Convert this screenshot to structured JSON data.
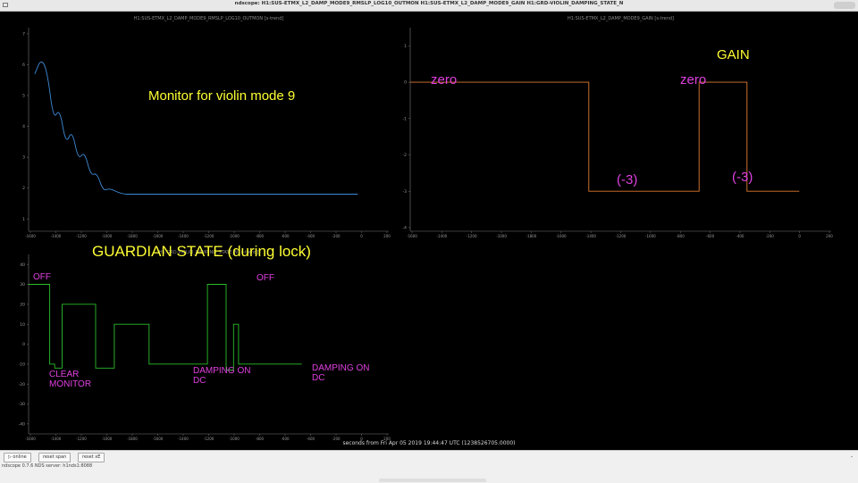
{
  "window": {
    "title": "ndscope: H1:SUS-ETMX_L2_DAMP_MODE9_RMSLP_LOG10_OUTMON H1:SUS-ETMX_L2_DAMP_MODE9_GAIN H1:GRD-VIOLIN_DAMPING_STATE_N"
  },
  "colors": {
    "monitor_trace": "#3d8bd6",
    "gain_trace": "#e07a2e",
    "guardian_trace": "#2bbd2b",
    "annotation_magenta": "#e040e0",
    "annotation_yellow": "#ffff33",
    "axis_text": "#9a9a9a"
  },
  "x_axis": {
    "label": "seconds from Fri Apr 05 2019 19:44:47 UTC (1238526705.0000)",
    "ticks": [
      "-1600",
      "-1400",
      "-1200",
      "-1000",
      "-1800",
      "-1600",
      "-1400",
      "-1200",
      "-1000",
      "-800",
      "-600",
      "-400",
      "-200",
      "0",
      "200"
    ]
  },
  "monitor_plot": {
    "title": "H1:SUS-ETMX_L2_DAMP_MODE9_RMSLP_LOG10_OUTMON [s-trend]",
    "annotation": "Monitor for violin mode 9",
    "y_ticks": [
      "7",
      "6",
      "5",
      "4",
      "3",
      "2",
      "1"
    ]
  },
  "gain_plot": {
    "title": "H1:SUS-ETMX_L2_DAMP_MODE9_GAIN [s-trend]",
    "y_ticks": [
      "1",
      "0",
      "-1",
      "-2",
      "-3",
      "-4"
    ],
    "annotations": {
      "heading": "GAIN",
      "zero_left": "zero",
      "zero_right": "zero",
      "minus_left": "(-3)",
      "minus_right": "(-3)"
    }
  },
  "guardian_plot": {
    "title": "H1:GRD-VIOLIN_DAMPING_STATE_N [s-trend]",
    "y_ticks": [
      "40",
      "30",
      "20",
      "10",
      "0",
      "-10",
      "-20",
      "-30",
      "-40"
    ],
    "annotations": {
      "heading": "GUARDIAN STATE (during lock)",
      "off_left": "OFF",
      "off_right": "OFF",
      "clear_monitor": "CLEAR\nMONITOR",
      "damping_left": "DAMPING ON\nDC",
      "damping_right": "DAMPING ON\nDC"
    }
  },
  "chart_data": [
    {
      "type": "line",
      "title": "H1:SUS-ETMX_L2_DAMP_MODE9_RMSLP_LOG10_OUTMON [s-trend]",
      "xlim": [
        -2650,
        250
      ],
      "ylim": [
        0.6,
        7.2
      ],
      "series": [
        {
          "x": [
            -2600,
            -2550,
            -2500,
            -2450,
            -2400,
            -2350,
            -2300,
            -2250,
            -2200,
            -2150,
            -2100,
            -2050,
            -2000,
            -1900,
            -1800,
            -1500,
            -1000,
            -500,
            0
          ],
          "y": [
            5.7,
            6.2,
            5.8,
            4.2,
            4.6,
            3.4,
            3.9,
            2.9,
            3.2,
            2.4,
            2.5,
            1.9,
            2.0,
            1.8,
            1.8,
            1.8,
            1.8,
            1.8,
            1.8
          ]
        }
      ]
    },
    {
      "type": "line",
      "title": "H1:SUS-ETMX_L2_DAMP_MODE9_GAIN [s-trend]",
      "xlim": [
        -2650,
        250
      ],
      "ylim": [
        -4.1,
        1.5
      ],
      "series": [
        {
          "x": [
            -2650,
            -1420,
            -1420,
            -660,
            -660,
            -330,
            -330,
            30
          ],
          "y": [
            0,
            0,
            -3,
            -3,
            0,
            0,
            -3,
            -3
          ]
        }
      ]
    },
    {
      "type": "line",
      "title": "H1:GRD-VIOLIN_DAMPING_STATE_N [s-trend]",
      "xlim": [
        -2650,
        250
      ],
      "ylim": [
        -45,
        45
      ],
      "series": [
        {
          "x": [
            -2650,
            -2480,
            -2480,
            -2440,
            -2440,
            -2380,
            -2380,
            -2110,
            -2110,
            -1960,
            -1960,
            -1680,
            -1680,
            -1210,
            -1210,
            -1060,
            -1060,
            -1000,
            -1000,
            -960,
            -960,
            -740,
            -740,
            -450
          ],
          "y": [
            30,
            30,
            -10,
            -10,
            -12,
            -12,
            20,
            20,
            -12,
            -12,
            10,
            10,
            -10,
            -10,
            30,
            30,
            -13,
            -13,
            10,
            10,
            -10,
            -10,
            -10,
            -10
          ]
        }
      ]
    }
  ],
  "buttons": {
    "online": "▷ online",
    "reset_span": "reset span",
    "reset_xy": "reset xE"
  },
  "status": "ndscope 0.7.6   NDS server: h1nds1:8088"
}
